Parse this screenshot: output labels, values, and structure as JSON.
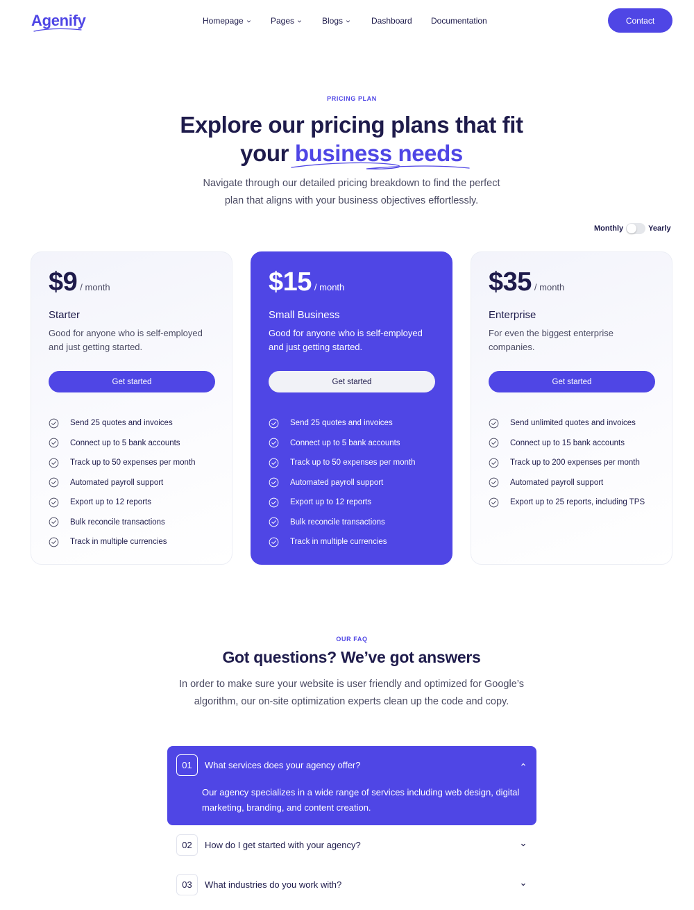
{
  "brand": {
    "name": "Agenify",
    "accent_color": "#4f46e5",
    "text_color": "#1e1b4b"
  },
  "nav": {
    "items": [
      {
        "label": "Homepage",
        "has_dropdown": true
      },
      {
        "label": "Pages",
        "has_dropdown": true
      },
      {
        "label": "Blogs",
        "has_dropdown": true
      },
      {
        "label": "Dashboard",
        "has_dropdown": false
      },
      {
        "label": "Documentation",
        "has_dropdown": false
      }
    ],
    "contact_label": "Contact"
  },
  "pricing": {
    "eyebrow": "PRICING PLAN",
    "title_line1": "Explore our pricing plans that fit",
    "title_line2_prefix": "your",
    "title_line2_accent": "business needs",
    "subtitle_line1": "Navigate through our detailed pricing breakdown to find the perfect",
    "subtitle_line2": "plan that aligns with your business objectives effortlessly.",
    "toggle": {
      "left_label": "Monthly",
      "right_label": "Yearly",
      "selected": "Monthly"
    },
    "plans": [
      {
        "price": "$9",
        "period": "/ month",
        "name": "Starter",
        "description": "Good for anyone who is self-employed and just getting started.",
        "button_label": "Get started",
        "featured": false,
        "features": [
          "Send 25 quotes and invoices",
          "Connect up to 5 bank accounts",
          "Track up to 50 expenses per month",
          "Automated payroll support",
          "Export up to 12 reports",
          "Bulk reconcile transactions",
          "Track in multiple currencies"
        ]
      },
      {
        "price": "$15",
        "period": "/ month",
        "name": "Small Business",
        "description": "Good for anyone who is self-employed and just getting started.",
        "button_label": "Get started",
        "featured": true,
        "features": [
          "Send 25 quotes and invoices",
          "Connect up to 5 bank accounts",
          "Track up to 50 expenses per month",
          "Automated payroll support",
          "Export up to 12 reports",
          "Bulk reconcile transactions",
          "Track in multiple currencies"
        ]
      },
      {
        "price": "$35",
        "period": "/ month",
        "name": "Enterprise",
        "description": "For even the biggest enterprise companies.",
        "button_label": "Get started",
        "featured": false,
        "features": [
          "Send unlimited quotes and invoices",
          "Connect up to 15 bank accounts",
          "Track up to 200 expenses per month",
          "Automated payroll support",
          "Export up to 25 reports, including TPS"
        ]
      }
    ]
  },
  "faq": {
    "eyebrow": "OUR FAQ",
    "title": "Got questions? We’ve got answers",
    "subtitle_line1": "In order to make sure your website is user friendly and optimized for Google’s",
    "subtitle_line2": "algorithm, our on-site optimization experts clean up the code and copy.",
    "items": [
      {
        "number": "01",
        "question": "What services does your agency offer?",
        "answer": "Our agency specializes in a wide range of services including web design, digital marketing, branding, and content creation.",
        "open": true
      },
      {
        "number": "02",
        "question": "How do I get started with your agency?",
        "open": false
      },
      {
        "number": "03",
        "question": "What industries do you work with?",
        "open": false
      }
    ]
  }
}
